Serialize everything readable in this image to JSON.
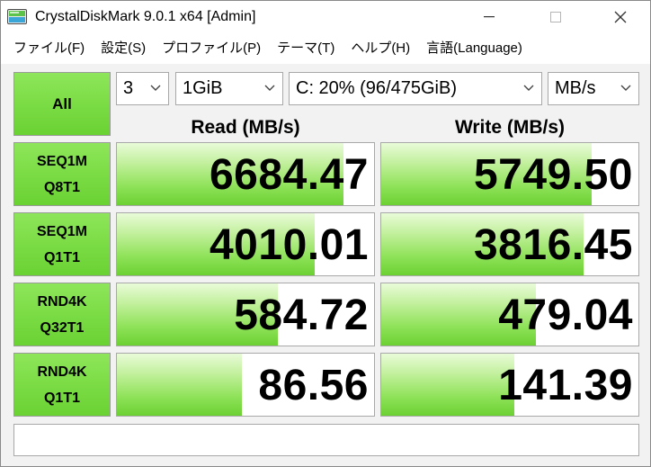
{
  "window": {
    "title": "CrystalDiskMark 9.0.1 x64 [Admin]",
    "icon": "crystaldiskmark-app-icon",
    "controls": [
      "minimize-icon",
      "maximize-icon",
      "close-icon"
    ]
  },
  "menu": [
    {
      "label": "ファイル(F)"
    },
    {
      "label": "設定(S)"
    },
    {
      "label": "プロファイル(P)"
    },
    {
      "label": "テーマ(T)"
    },
    {
      "label": "ヘルプ(H)"
    },
    {
      "label": "言語(Language)"
    }
  ],
  "controls": {
    "all_label": "All",
    "count": "3",
    "size": "1GiB",
    "drive": "C: 20% (96/475GiB)",
    "unit": "MB/s"
  },
  "headers": {
    "read": "Read (MB/s)",
    "write": "Write (MB/s)"
  },
  "tests": [
    {
      "line1": "SEQ1M",
      "line2": "Q8T1",
      "read": "6684.47",
      "write": "5749.50",
      "read_fill": 0.88,
      "write_fill": 0.818
    },
    {
      "line1": "SEQ1M",
      "line2": "Q1T1",
      "read": "4010.01",
      "write": "3816.45",
      "read_fill": 0.77,
      "write_fill": 0.788
    },
    {
      "line1": "RND4K",
      "line2": "Q32T1",
      "read": "584.72",
      "write": "479.04",
      "read_fill": 0.627,
      "write_fill": 0.603
    },
    {
      "line1": "RND4K",
      "line2": "Q1T1",
      "read": "86.56",
      "write": "141.39",
      "read_fill": 0.485,
      "write_fill": 0.518
    }
  ],
  "status": "",
  "colors": {
    "accent_green": "#7bdc45",
    "bar_light": "#e9fbd8",
    "bar_dark": "#6cd133"
  }
}
